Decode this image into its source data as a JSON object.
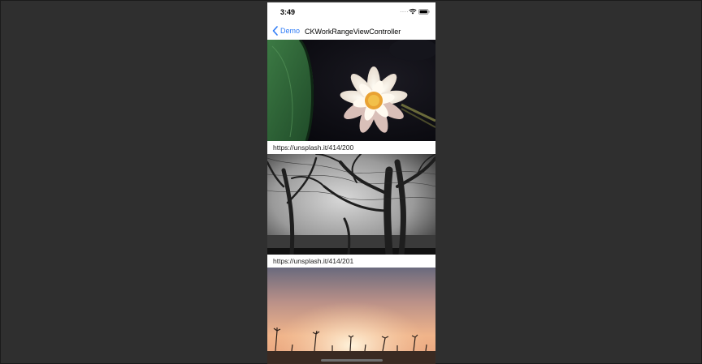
{
  "status_bar": {
    "time": "3:49"
  },
  "nav_bar": {
    "back_label": "Demo",
    "title": "CKWorkRangeViewController"
  },
  "feed": {
    "items": [
      {
        "caption": "https://unsplash.it/414/200",
        "image": "water-lily"
      },
      {
        "caption": "https://unsplash.it/414/201",
        "image": "black-and-white-trees"
      },
      {
        "caption": "",
        "image": "sunset-palms"
      }
    ]
  },
  "colors": {
    "background": "#2f2f2f",
    "accent": "#2f7cf6"
  }
}
